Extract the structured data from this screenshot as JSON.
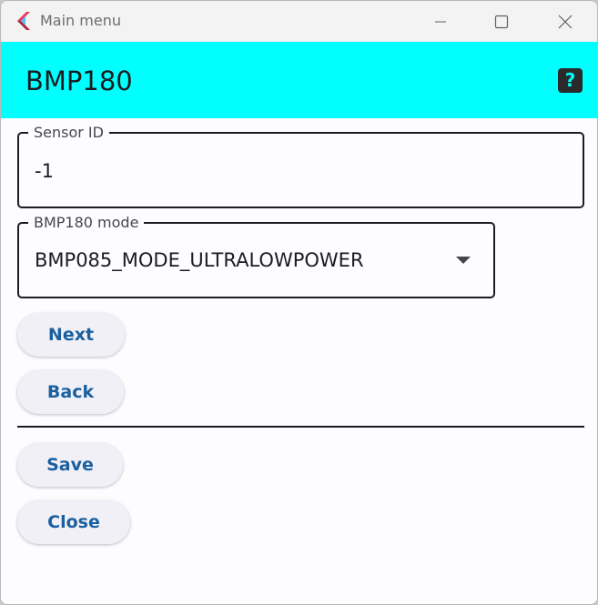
{
  "window": {
    "title": "Main menu"
  },
  "appbar": {
    "title": "BMP180",
    "help_label": "?"
  },
  "fields": {
    "sensor_id": {
      "label": "Sensor ID",
      "value": "-1"
    },
    "mode": {
      "label": "BMP180 mode",
      "value": "BMP085_MODE_ULTRALOWPOWER"
    }
  },
  "buttons": {
    "next": "Next",
    "back": "Back",
    "save": "Save",
    "close": "Close"
  },
  "colors": {
    "appbar": "#00ffff",
    "button_text": "#1a5fa0",
    "button_bg": "#f1f0f7"
  },
  "icons": {
    "app": "flutter-logo-icon",
    "minimize": "minimize-icon",
    "maximize": "maximize-icon",
    "close": "close-icon",
    "help": "help-icon",
    "dropdown": "dropdown-arrow-icon"
  }
}
